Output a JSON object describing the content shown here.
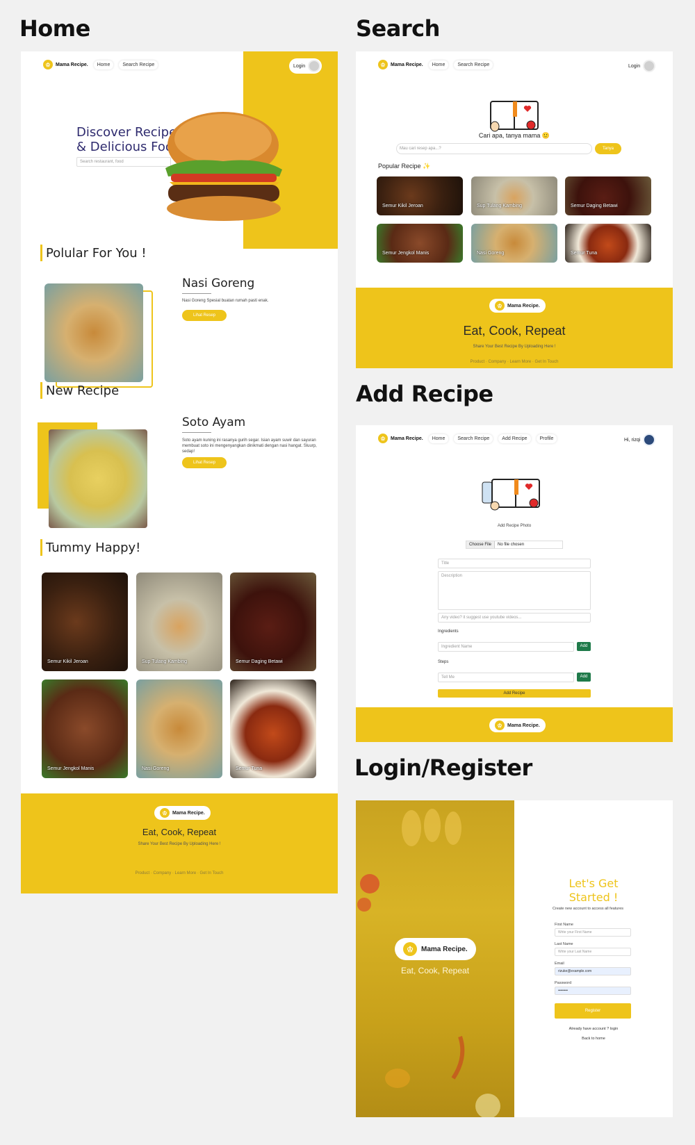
{
  "sections": {
    "home": "Home",
    "search": "Search",
    "add_recipe": "Add Recipe",
    "login_register": "Login/Register"
  },
  "brand": "Mama Recipe.",
  "colors": {
    "accent": "#eec41b",
    "hero_text": "#2e2a6e",
    "add_btn": "#1f7a4a"
  },
  "home": {
    "nav": {
      "home": "Home",
      "search": "Search Recipe",
      "login": "Login"
    },
    "hero_title_1": "Discover Recipe",
    "hero_title_2": "& Delicious Food",
    "search_placeholder": "Search restaurant, food",
    "popular_heading": "Polular For You !",
    "popular_title": "Nasi Goreng",
    "popular_desc": "Nasi Goreng Spesial buatan rumah pasti enak.",
    "popular_btn": "Lihat Resep",
    "new_heading": "New Recipe",
    "new_title": "Soto Ayam",
    "new_desc": "Soto ayam kuning ini rasanya gurih segar. Isian ayam suwir dan sayuran membuat soto ini mengenyangkan dinikmati dengan nasi hangat. Sluurp, sedap!",
    "new_btn": "Lihat Resep",
    "tummy_heading": "Tummy Happy!",
    "tummy_items": [
      "Semur Kikil Jeroan",
      "Sup Tulang Kambing",
      "Semur Daging Betawi",
      "Semur Jengkol Manis",
      "Nasi Goreng",
      "Semur Tuna"
    ],
    "footer_tagline": "Eat, Cook, Repeat",
    "footer_sub": "Share Your Best Recipe By Uploading Here !",
    "footer_links": "Product · Company · Learn More · Get In Touch"
  },
  "search": {
    "nav": {
      "home": "Home",
      "search": "Search Recipe",
      "login": "Login"
    },
    "prompt": "Cari apa, tanya mama 🙂",
    "input_placeholder": "Mau cari resep apa...?",
    "button": "Tanya",
    "popular_label": "Popular Recipe ✨",
    "items": [
      "Semur Kikil Jeroan",
      "Sup Tulang Kambing",
      "Semur Daging Betawi",
      "Semur Jengkol Manis",
      "Nasi Goreng",
      "Semur Tuna"
    ],
    "footer_tagline": "Eat, Cook, Repeat",
    "footer_sub": "Share Your Best Recipe By Uploading Here !",
    "footer_links": "Product · Company · Learn More · Get In Touch"
  },
  "add": {
    "nav": {
      "home": "Home",
      "search": "Search Recipe",
      "add": "Add Recipe",
      "profile": "Profile",
      "greeting": "Hi, rizqi"
    },
    "photo_label": "Add Recipe Photo",
    "choose_file": "Choose File",
    "no_file": "No file chosen",
    "title_ph": "Title",
    "desc_ph": "Description",
    "video_ph": "Any video? it suggest use youtube videos...",
    "ingredients_label": "Ingredients",
    "ingredient_ph": "Ingredient Name",
    "add_btn": "Add",
    "steps_label": "Steps",
    "steps_ph": "Tell Me",
    "submit": "Add Recipe"
  },
  "login": {
    "tagline": "Eat, Cook, Repeat",
    "heading_1": "Let's Get",
    "heading_2": "Started !",
    "sub": "Create new account to access all features",
    "first_name_label": "First Name",
    "first_name_ph": "Write your First Name",
    "last_name_label": "Last Name",
    "last_name_ph": "Write your Last Name",
    "email_label": "Email",
    "email_value": "rizuke@example.com",
    "password_label": "Password",
    "password_value": "••••••••",
    "register_btn": "Register",
    "already": "Already have account ? login",
    "back_home": "Back to home"
  }
}
